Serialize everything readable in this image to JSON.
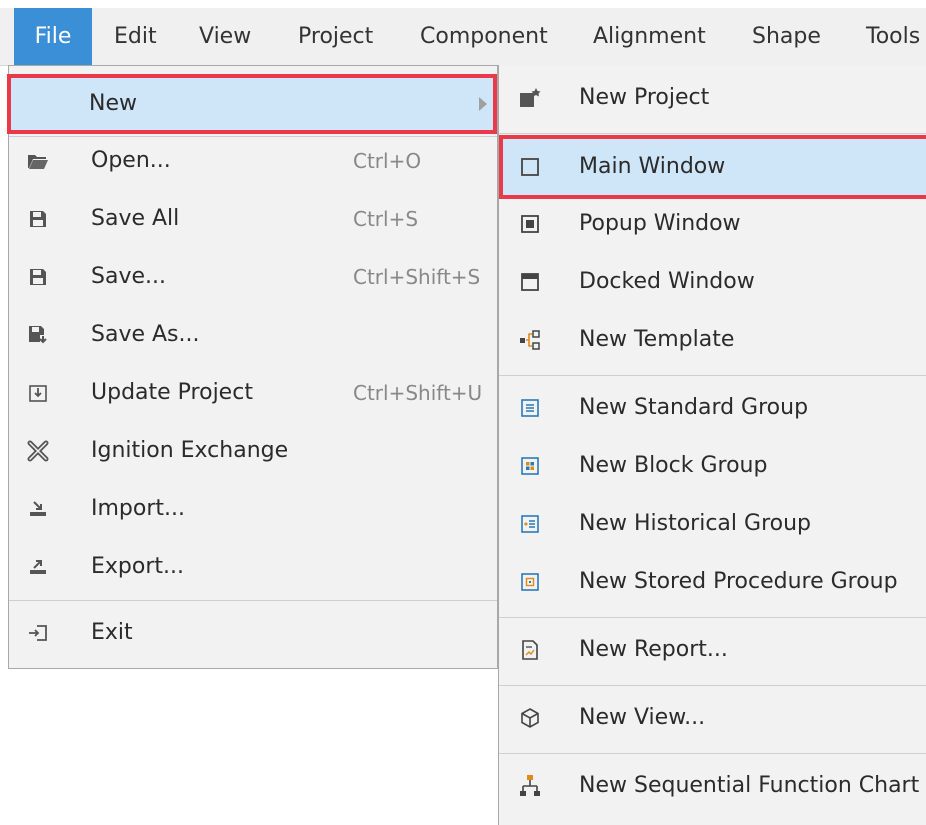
{
  "menubar": {
    "items": [
      {
        "label": "File"
      },
      {
        "label": "Edit"
      },
      {
        "label": "View"
      },
      {
        "label": "Project"
      },
      {
        "label": "Component"
      },
      {
        "label": "Alignment"
      },
      {
        "label": "Shape"
      },
      {
        "label": "Tools"
      }
    ]
  },
  "file_menu": {
    "new_label": "New",
    "items": [
      {
        "label": "Open...",
        "shortcut": "Ctrl+O",
        "icon": "folder-open-icon"
      },
      {
        "label": "Save All",
        "shortcut": "Ctrl+S",
        "icon": "save-all-icon"
      },
      {
        "label": "Save...",
        "shortcut": "Ctrl+Shift+S",
        "icon": "save-icon"
      },
      {
        "label": "Save As...",
        "shortcut": "",
        "icon": "save-as-icon"
      },
      {
        "label": "Update Project",
        "shortcut": "Ctrl+Shift+U",
        "icon": "update-project-icon"
      },
      {
        "label": "Ignition Exchange",
        "shortcut": "",
        "icon": "exchange-icon"
      },
      {
        "label": "Import...",
        "shortcut": "",
        "icon": "import-icon"
      },
      {
        "label": "Export...",
        "shortcut": "",
        "icon": "export-icon"
      },
      {
        "label": "Exit",
        "shortcut": "",
        "icon": "exit-icon"
      }
    ]
  },
  "new_submenu": {
    "items": [
      {
        "label": "New Project",
        "icon": "new-project-icon"
      },
      {
        "label": "Main Window",
        "icon": "main-window-icon"
      },
      {
        "label": "Popup Window",
        "icon": "popup-window-icon"
      },
      {
        "label": "Docked Window",
        "icon": "docked-window-icon"
      },
      {
        "label": "New Template",
        "icon": "template-icon"
      },
      {
        "label": "New Standard Group",
        "icon": "standard-group-icon"
      },
      {
        "label": "New Block Group",
        "icon": "block-group-icon"
      },
      {
        "label": "New Historical Group",
        "icon": "historical-group-icon"
      },
      {
        "label": "New Stored Procedure Group",
        "icon": "stored-procedure-group-icon"
      },
      {
        "label": "New Report...",
        "icon": "report-icon"
      },
      {
        "label": "New View...",
        "icon": "view-cube-icon"
      },
      {
        "label": "New Sequential Function Chart",
        "icon": "sfc-icon"
      }
    ]
  },
  "colors": {
    "highlight": "#cfe6f8",
    "annotation_red": "#ea3a4a",
    "active_menu": "#3a8fd6"
  }
}
